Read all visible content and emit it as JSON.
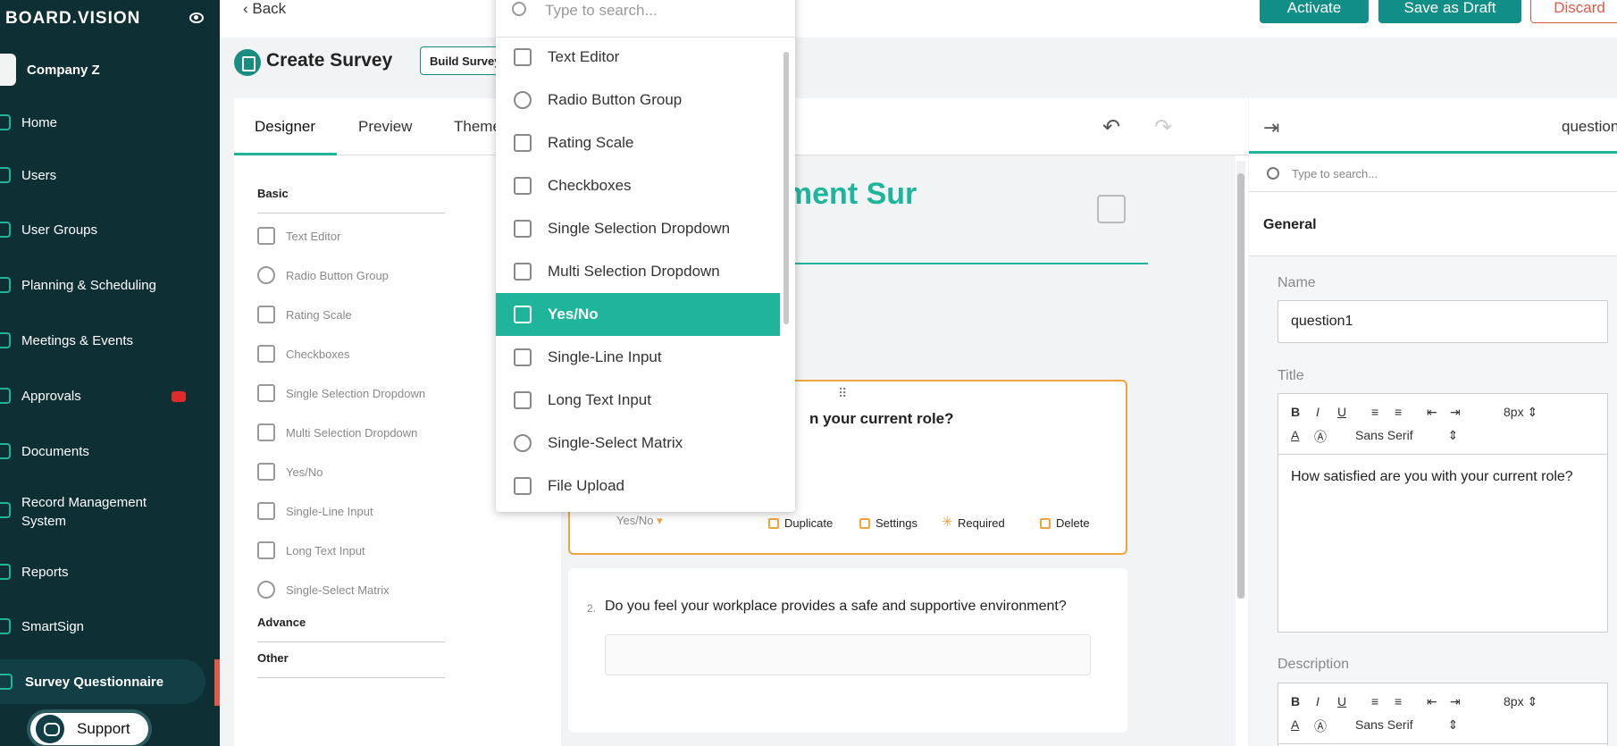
{
  "sidebar": {
    "brand": "BOARD.VISION",
    "company": "Company Z",
    "items": [
      {
        "label": "Home"
      },
      {
        "label": "Users"
      },
      {
        "label": "User Groups"
      },
      {
        "label": "Planning & Scheduling"
      },
      {
        "label": "Meetings & Events"
      },
      {
        "label": "Approvals"
      },
      {
        "label": "Documents"
      },
      {
        "label": "Record Management System"
      },
      {
        "label": "Reports"
      },
      {
        "label": "SmartSign"
      },
      {
        "label": "Survey Questionnaire"
      }
    ],
    "support_label": "Support"
  },
  "topbar": {
    "back_label": "Back",
    "activate_label": "Activate",
    "draft_label": "Save as Draft",
    "discard_label": "Discard"
  },
  "header": {
    "title": "Create Survey",
    "build_label": "Build Survey"
  },
  "designer": {
    "tabs": [
      {
        "label": "Designer"
      },
      {
        "label": "Preview"
      },
      {
        "label": "Themes"
      }
    ],
    "toolbox": {
      "basic_label": "Basic",
      "items": [
        {
          "label": "Text Editor"
        },
        {
          "label": "Radio Button Group"
        },
        {
          "label": "Rating Scale"
        },
        {
          "label": "Checkboxes"
        },
        {
          "label": "Single Selection Dropdown"
        },
        {
          "label": "Multi Selection Dropdown"
        },
        {
          "label": "Yes/No"
        },
        {
          "label": "Single-Line Input"
        },
        {
          "label": "Long Text Input"
        },
        {
          "label": "Single-Select Matrix"
        }
      ],
      "advance_label": "Advance",
      "other_label": "Other"
    },
    "survey_title": "ement Sur",
    "q1": {
      "text": "n your current role?",
      "type": "Yes/No",
      "actions": [
        "Duplicate",
        "Settings",
        "Required",
        "Delete"
      ]
    },
    "q2": {
      "number": "2.",
      "text": "Do you feel your workplace provides a safe and supportive environment?"
    }
  },
  "dropdown": {
    "placeholder": "Type to search...",
    "items": [
      {
        "label": "Text Editor"
      },
      {
        "label": "Radio Button Group"
      },
      {
        "label": "Rating Scale"
      },
      {
        "label": "Checkboxes"
      },
      {
        "label": "Single Selection Dropdown"
      },
      {
        "label": "Multi Selection Dropdown"
      },
      {
        "label": "Yes/No",
        "selected": true
      },
      {
        "label": "Single-Line Input"
      },
      {
        "label": "Long Text Input"
      },
      {
        "label": "Single-Select Matrix"
      },
      {
        "label": "File Upload"
      }
    ]
  },
  "panel": {
    "title": "question",
    "search_placeholder": "Type to search...",
    "general_label": "General",
    "name_label": "Name",
    "name_value": "question1",
    "title_label": "Title",
    "font_size": "8px",
    "font_family": "Sans Serif",
    "title_value": "How satisfied are you with your current role?",
    "description_label": "Description"
  },
  "colors": {
    "sidebar_bg": "#0e2f34",
    "accent": "#1fb59b",
    "button": "#118f86",
    "discard": "#e05a47",
    "highlight_border": "#f0a53c"
  }
}
